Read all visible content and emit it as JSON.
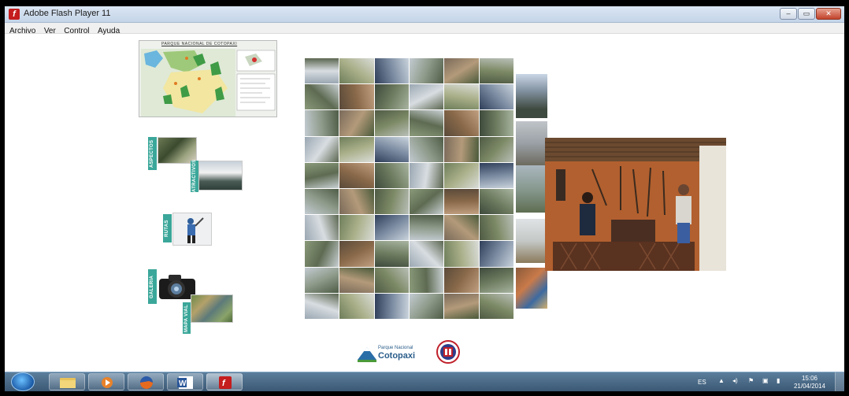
{
  "window": {
    "title": "Adobe Flash Player 11"
  },
  "menu": [
    "Archivo",
    "Ver",
    "Control",
    "Ayuda"
  ],
  "map": {
    "title": "PARQUE NACIONAL DE COTOPAXI"
  },
  "nav": {
    "aspectos": "ASPECTOS",
    "atractivos": "ATRACTIVOS",
    "rutas": "RUTAS",
    "galeria": "GALERIA",
    "mapa_vial": "MAPA VIAL"
  },
  "logos": {
    "parque_line1": "Parque Nacional",
    "parque_line2": "Cotopaxi"
  },
  "taskbar": {
    "language": "ES",
    "time": "15:06",
    "date": "21/04/2014"
  },
  "colors": {
    "accent": "#3ba79a",
    "taskbar": "#4a6b89"
  },
  "icons": [
    "flash-icon",
    "explorer-icon",
    "media-player-icon",
    "firefox-icon",
    "word-icon",
    "flash-player-icon"
  ]
}
